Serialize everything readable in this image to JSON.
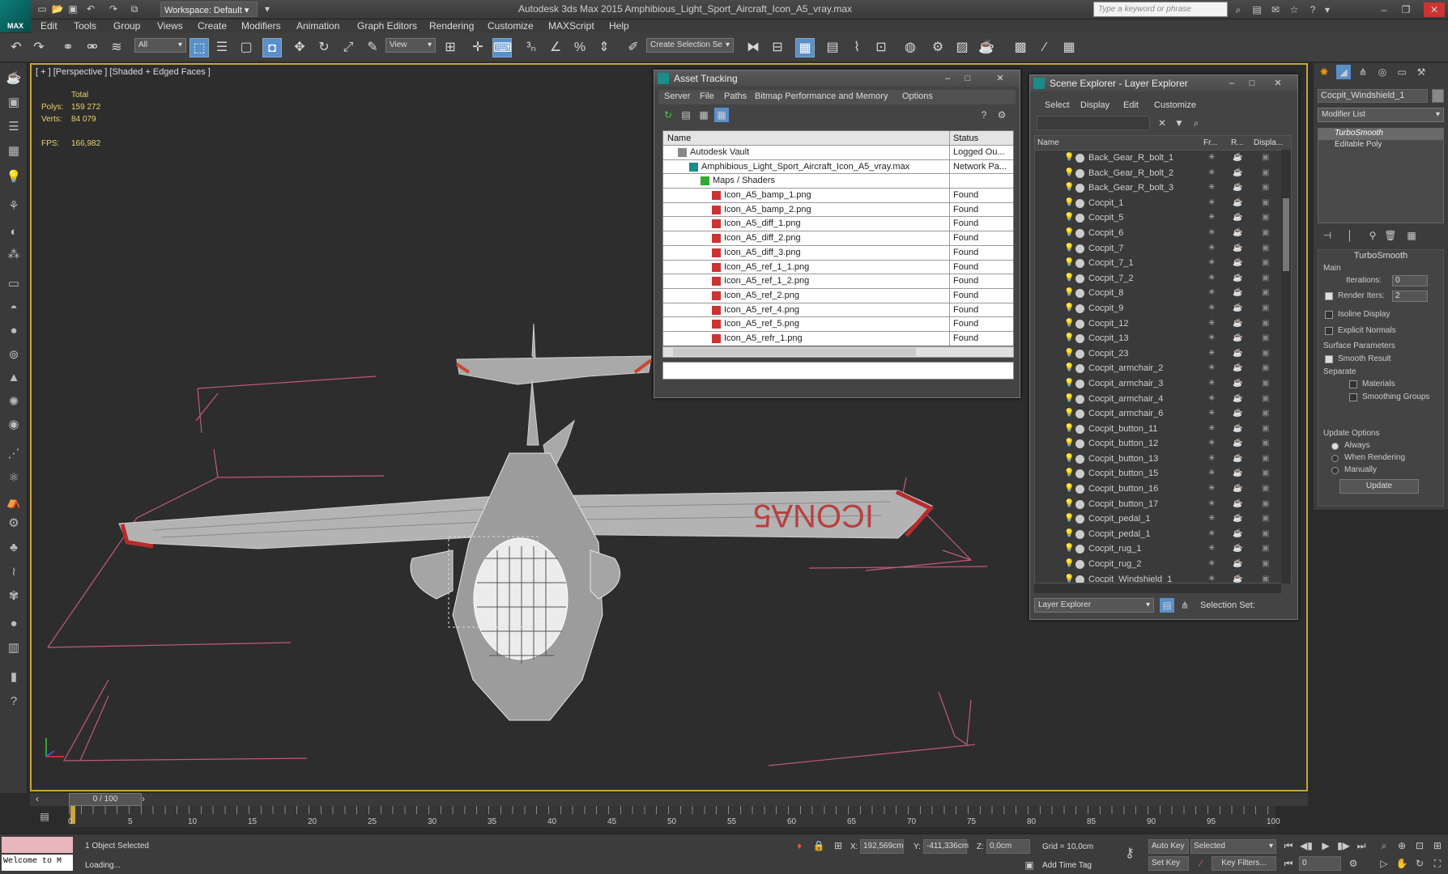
{
  "app": {
    "title": "Autodesk 3ds Max 2015    Amphibious_Light_Sport_Aircraft_Icon_A5_vray.max",
    "logo": "MAX",
    "workspace": "Workspace: Default",
    "search_placeholder": "Type a keyword or phrase"
  },
  "menu": [
    "Edit",
    "Tools",
    "Group",
    "Views",
    "Create",
    "Modifiers",
    "Animation",
    "Graph Editors",
    "Rendering",
    "Customize",
    "MAXScript",
    "Help"
  ],
  "toolbar": {
    "selection_filter": "All",
    "ref_coord": "View",
    "selection_set": "Create Selection Se"
  },
  "viewport": {
    "label": "[ + ] [Perspective ] [Shaded + Edged Faces ]",
    "stats_header": "Total",
    "polys_label": "Polys:",
    "polys_value": "159 272",
    "verts_label": "Verts:",
    "verts_value": "84 079",
    "fps_label": "FPS:",
    "fps_value": "166,982"
  },
  "asset_tracking": {
    "title": "Asset Tracking",
    "menu": [
      "Server",
      "File",
      "Paths",
      "Bitmap Performance and Memory",
      "Options"
    ],
    "col_name": "Name",
    "col_status": "Status",
    "rows": [
      {
        "name": "Autodesk Vault",
        "status": "Logged Ou..."
      },
      {
        "name": "Amphibious_Light_Sport_Aircraft_Icon_A5_vray.max",
        "status": "Network Pa..."
      },
      {
        "name": "Maps / Shaders",
        "status": ""
      },
      {
        "name": "Icon_A5_bamp_1.png",
        "status": "Found"
      },
      {
        "name": "Icon_A5_bamp_2.png",
        "status": "Found"
      },
      {
        "name": "Icon_A5_diff_1.png",
        "status": "Found"
      },
      {
        "name": "Icon_A5_diff_2.png",
        "status": "Found"
      },
      {
        "name": "Icon_A5_diff_3.png",
        "status": "Found"
      },
      {
        "name": "Icon_A5_ref_1_1.png",
        "status": "Found"
      },
      {
        "name": "Icon_A5_ref_1_2.png",
        "status": "Found"
      },
      {
        "name": "Icon_A5_ref_2.png",
        "status": "Found"
      },
      {
        "name": "Icon_A5_ref_4.png",
        "status": "Found"
      },
      {
        "name": "Icon_A5_ref_5.png",
        "status": "Found"
      },
      {
        "name": "Icon_A5_refr_1.png",
        "status": "Found"
      }
    ]
  },
  "scene_explorer": {
    "title": "Scene Explorer - Layer Explorer",
    "menu": [
      "Select",
      "Display",
      "Edit",
      "Customize"
    ],
    "col_name": "Name",
    "col_fr": "Fr...",
    "col_r": "R...",
    "col_disp": "Displa...",
    "items": [
      "Back_Gear_R_bolt_1",
      "Back_Gear_R_bolt_2",
      "Back_Gear_R_bolt_3",
      "Cocpit_1",
      "Cocpit_5",
      "Cocpit_6",
      "Cocpit_7",
      "Cocpit_7_1",
      "Cocpit_7_2",
      "Cocpit_8",
      "Cocpit_9",
      "Cocpit_12",
      "Cocpit_13",
      "Cocpit_23",
      "Cocpit_armchair_2",
      "Cocpit_armchair_3",
      "Cocpit_armchair_4",
      "Cocpit_armchair_6",
      "Cocpit_button_11",
      "Cocpit_button_12",
      "Cocpit_button_13",
      "Cocpit_button_15",
      "Cocpit_button_16",
      "Cocpit_button_17",
      "Cocpit_pedal_1",
      "Cocpit_pedal_1",
      "Cocpit_rug_1",
      "Cocpit_rug_2",
      "Cocpit_Windshield_1"
    ],
    "footer_combo": "Layer Explorer",
    "selection_set_label": "Selection Set:"
  },
  "command_panel": {
    "object_name": "Cocpit_Windshield_1",
    "modifier_list": "Modifier List",
    "stack": [
      "TurboSmooth",
      "Editable Poly"
    ],
    "rollout_title": "TurboSmooth",
    "main_label": "Main",
    "iterations_label": "Iterations:",
    "iterations_value": "0",
    "render_iters_label": "Render Iters:",
    "render_iters_value": "2",
    "isoline": "Isoline Display",
    "explicit_normals": "Explicit Normals",
    "surface_params": "Surface Parameters",
    "smooth_result": "Smooth Result",
    "separate": "Separate",
    "materials": "Materials",
    "smoothing_groups": "Smoothing Groups",
    "update_options": "Update Options",
    "always": "Always",
    "when_rendering": "When Rendering",
    "manually": "Manually",
    "update_button": "Update"
  },
  "timeline": {
    "slider_label": "0 / 100",
    "ticks": [
      "0",
      "5",
      "10",
      "15",
      "20",
      "25",
      "30",
      "35",
      "40",
      "45",
      "50",
      "55",
      "60",
      "65",
      "70",
      "75",
      "80",
      "85",
      "90",
      "95",
      "100"
    ]
  },
  "status": {
    "maxscript": "Welcome to M",
    "selected": "1 Object Selected",
    "loading": "Loading...",
    "x_label": "X:",
    "x_value": "192,569cm",
    "y_label": "Y:",
    "y_value": "-411,336cm",
    "z_label": "Z:",
    "z_value": "0,0cm",
    "grid": "Grid = 10,0cm",
    "add_time_tag": "Add Time Tag",
    "auto_key": "Auto Key",
    "set_key": "Set Key",
    "key_mode": "Selected",
    "key_filters": "Key Filters...",
    "frame": "0"
  },
  "colors": {
    "accent": "#c8a43a",
    "selection": "#5a8fc7",
    "brand": "#0e7d7a"
  }
}
